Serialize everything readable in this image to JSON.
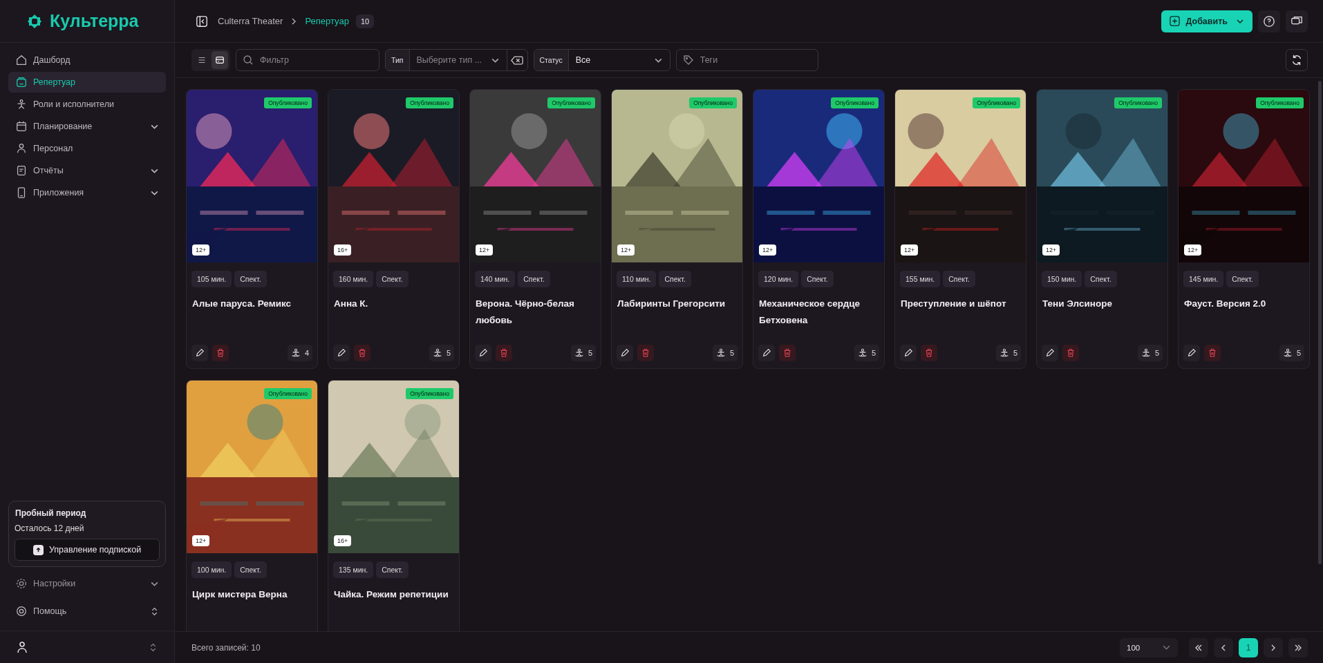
{
  "brand": {
    "name": "Культерра"
  },
  "sidebar": {
    "items": [
      {
        "label": "Дашборд",
        "kind": "link",
        "selected": false
      },
      {
        "label": "Репертуар",
        "kind": "link",
        "selected": true
      },
      {
        "label": "Роли и исполнители",
        "kind": "link",
        "selected": false
      },
      {
        "label": "Планирование",
        "kind": "group",
        "selected": false
      },
      {
        "label": "Персонал",
        "kind": "link",
        "selected": false
      },
      {
        "label": "Отчёты",
        "kind": "group",
        "selected": false
      },
      {
        "label": "Приложения",
        "kind": "group",
        "selected": false
      }
    ]
  },
  "trial": {
    "title": "Пробный период",
    "remaining": "Осталось 12 дней",
    "button": "Управление подпиской"
  },
  "sidebar_bottom": [
    {
      "label": "Настройки",
      "kind": "dropdown"
    },
    {
      "label": "Помощь",
      "kind": "menu"
    }
  ],
  "breadcrumb": {
    "items": [
      "Culterra Theater",
      "Репертуар"
    ],
    "count": "10"
  },
  "header": {
    "add_button": "Добавить"
  },
  "filters": {
    "view_modes": [
      {
        "kind": "list",
        "selected": false
      },
      {
        "kind": "grid",
        "selected": true
      }
    ],
    "search_placeholder": "Фильтр",
    "type_label": "Тип",
    "type_placeholder": "Выберите тип ...",
    "status_label": "Статус",
    "status_value": "Все",
    "tags_placeholder": "Теги"
  },
  "cards": [
    {
      "title": "Алые паруса. Ремикс",
      "duration": "105 мин.",
      "type": "Спект.",
      "age": "12+",
      "status": "Опубликовано",
      "roles": "4"
    },
    {
      "title": "Анна К.",
      "duration": "160 мин.",
      "type": "Спект.",
      "age": "16+",
      "status": "Опубликовано",
      "roles": "5"
    },
    {
      "title": "Верона. Чёрно-белая любовь",
      "duration": "140 мин.",
      "type": "Спект.",
      "age": "12+",
      "status": "Опубликовано",
      "roles": "5"
    },
    {
      "title": "Лабиринты Грегорсити",
      "duration": "110 мин.",
      "type": "Спект.",
      "age": "12+",
      "status": "Опубликовано",
      "roles": "5"
    },
    {
      "title": "Механическое сердце Бетховена",
      "duration": "120 мин.",
      "type": "Спект.",
      "age": "12+",
      "status": "Опубликовано",
      "roles": "5"
    },
    {
      "title": "Преступление и шёпот",
      "duration": "155 мин.",
      "type": "Спект.",
      "age": "12+",
      "status": "Опубликовано",
      "roles": "5"
    },
    {
      "title": "Тени Элсиноре",
      "duration": "150 мин.",
      "type": "Спект.",
      "age": "12+",
      "status": "Опубликовано",
      "roles": "5"
    },
    {
      "title": "Фауст. Версия 2.0",
      "duration": "145 мин.",
      "type": "Спект.",
      "age": "12+",
      "status": "Опубликовано",
      "roles": "5"
    },
    {
      "title": "Цирк мистера Верна",
      "duration": "100 мин.",
      "type": "Спект.",
      "age": "12+",
      "status": "Опубликовано"
    },
    {
      "title": "Чайка. Режим репетиции",
      "duration": "135 мин.",
      "type": "Спект.",
      "age": "16+",
      "status": "Опубликовано"
    }
  ],
  "footer": {
    "total": "Всего записей: 10",
    "page_size": "100",
    "pages": [
      {
        "label": "1",
        "selected": true
      }
    ]
  }
}
